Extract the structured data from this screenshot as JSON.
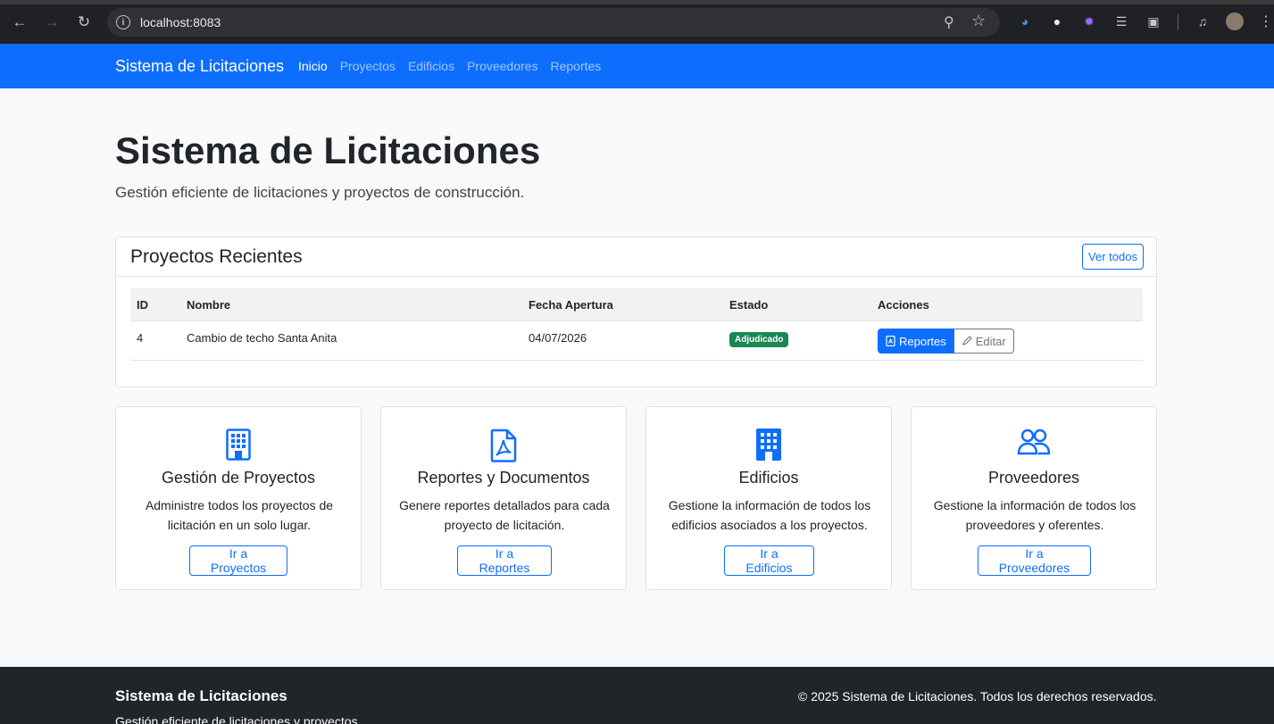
{
  "browser": {
    "url": "localhost:8083"
  },
  "navbar": {
    "brand": "Sistema de Licitaciones",
    "links": [
      "Inicio",
      "Proyectos",
      "Edificios",
      "Proveedores",
      "Reportes"
    ],
    "active": "Inicio"
  },
  "hero": {
    "title": "Sistema de Licitaciones",
    "subtitle": "Gestión eficiente de licitaciones y proyectos de construcción."
  },
  "recent": {
    "title": "Proyectos Recientes",
    "view_all": "Ver todos",
    "columns": [
      "ID",
      "Nombre",
      "Fecha Apertura",
      "Estado",
      "Acciones"
    ],
    "rows": [
      {
        "id": "4",
        "name": "Cambio de techo Santa Anita",
        "date": "04/07/2026",
        "status": "Adjudicado",
        "actions": [
          "Reportes",
          "Editar"
        ]
      }
    ]
  },
  "features": [
    {
      "icon": "building-icon",
      "title": "Gestión de Proyectos",
      "desc": "Administre todos los proyectos de licitación en un solo lugar.",
      "button": "Ir a Proyectos"
    },
    {
      "icon": "pdf-file-icon",
      "title": "Reportes y Documentos",
      "desc": "Genere reportes detallados para cada proyecto de licitación.",
      "button": "Ir a Reportes"
    },
    {
      "icon": "building-fill-icon",
      "title": "Edificios",
      "desc": "Gestione la información de todos los edificios asociados a los proyectos.",
      "button": "Ir a Edificios"
    },
    {
      "icon": "people-icon",
      "title": "Proveedores",
      "desc": "Gestione la información de todos los proveedores y oferentes.",
      "button": "Ir a Proveedores"
    }
  ],
  "footer": {
    "title": "Sistema de Licitaciones",
    "subtitle": "Gestión eficiente de licitaciones y proyectos",
    "copyright": "© 2025 Sistema de Licitaciones. Todos los derechos reservados."
  },
  "colors": {
    "primary": "#0d6efd",
    "success": "#198754",
    "dark": "#212529",
    "background": "#f8f9fa"
  }
}
